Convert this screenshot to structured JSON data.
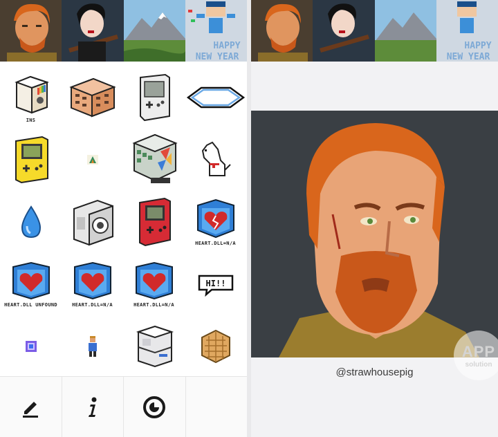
{
  "thumbnails": [
    {
      "name": "redhead-man-portrait"
    },
    {
      "name": "woman-with-rifle-portrait"
    },
    {
      "name": "mountain-landscape"
    },
    {
      "name": "happy-new-year-character",
      "text_top": "HAPPY",
      "text_bottom": "NEW YEAR"
    }
  ],
  "grid_items": [
    {
      "name": "instagram-box-icon",
      "caption": "INS"
    },
    {
      "name": "building-icon",
      "caption": ""
    },
    {
      "name": "white-gameboy-icon",
      "caption": ""
    },
    {
      "name": "hexagon-outline-icon",
      "caption": ""
    },
    {
      "name": "yellow-gameboy-icon",
      "caption": ""
    },
    {
      "name": "tiny-logo-icon",
      "caption": ""
    },
    {
      "name": "glass-building-icon",
      "caption": ""
    },
    {
      "name": "dog-icon",
      "caption": ""
    },
    {
      "name": "water-drop-icon",
      "caption": ""
    },
    {
      "name": "camera-icon",
      "caption": ""
    },
    {
      "name": "red-gameboy-icon",
      "caption": ""
    },
    {
      "name": "heart-cube-cracked-icon",
      "caption": "HEART.DLL=N/A"
    },
    {
      "name": "heart-cube-icon",
      "caption": "HEART.DLL UNFOUND"
    },
    {
      "name": "heart-cube-icon",
      "caption": "HEART.DLL=N/A"
    },
    {
      "name": "heart-cube-icon",
      "caption": "HEART.DLL=N/A"
    },
    {
      "name": "speech-bubble-icon",
      "caption": "",
      "text": "HI!!"
    },
    {
      "name": "purple-gem-icon",
      "caption": ""
    },
    {
      "name": "tiny-person-icon",
      "caption": ""
    },
    {
      "name": "server-box-icon",
      "caption": ""
    },
    {
      "name": "waffle-hexagon-icon",
      "caption": ""
    }
  ],
  "toolbar": [
    {
      "name": "edit-pencil-icon"
    },
    {
      "name": "info-icon"
    },
    {
      "name": "timer-icon"
    }
  ],
  "detail": {
    "author": "@strawhousepig",
    "watermark_top": "APP",
    "watermark_bottom": "solution"
  },
  "colors": {
    "hair": "#d9661c",
    "skin": "#e8a477",
    "shirt": "#9b7d2e",
    "bg": "#3a3f44"
  }
}
